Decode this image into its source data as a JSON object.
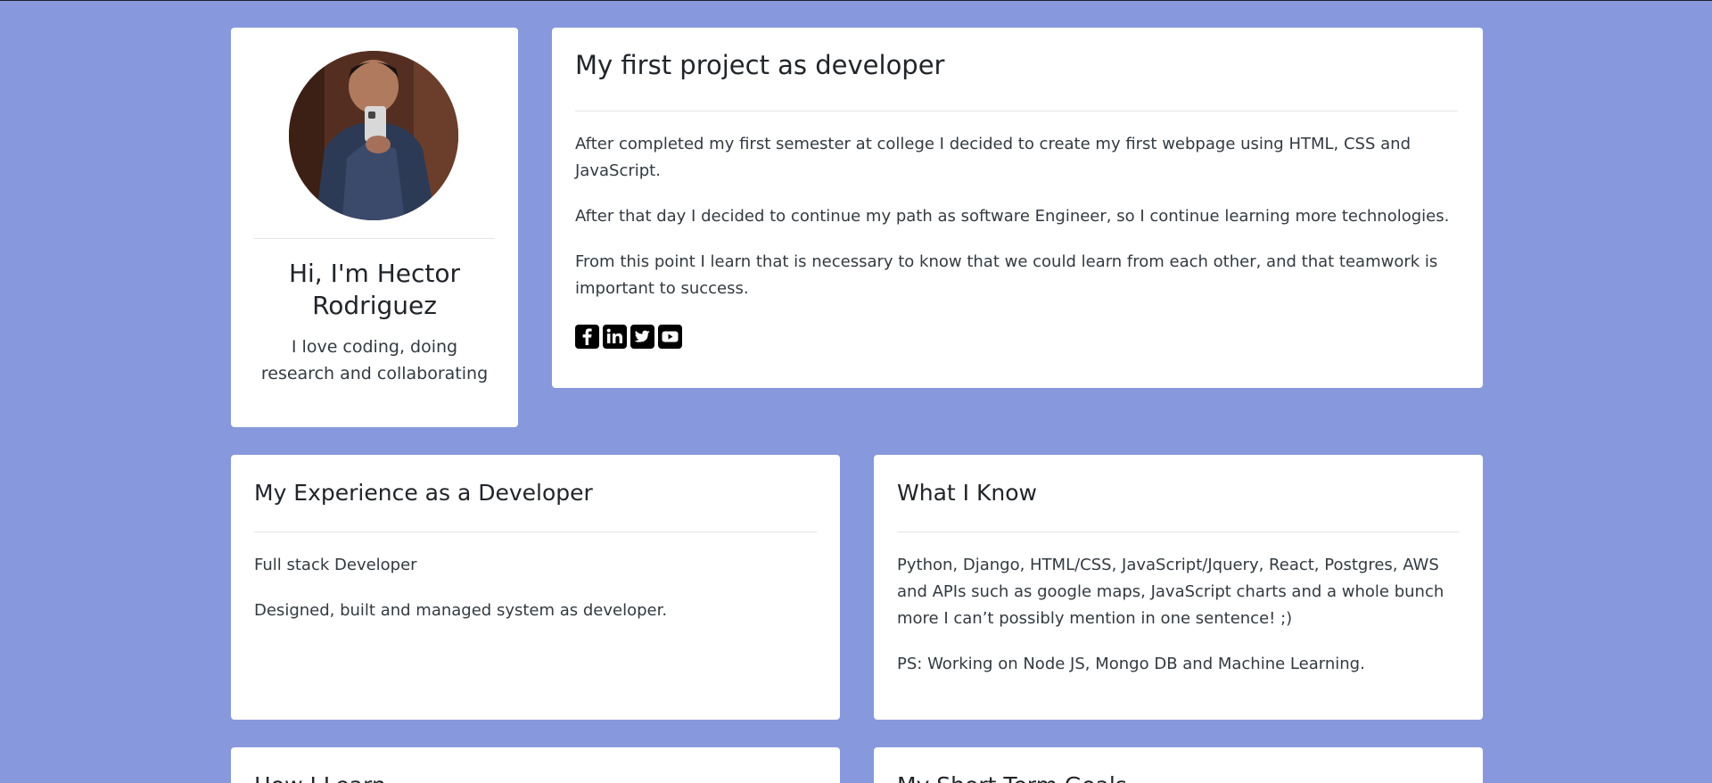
{
  "profile": {
    "name": "Hi, I'm Hector Rodriguez",
    "tagline": "I love coding, doing research and collaborating"
  },
  "project": {
    "title": "My first project as developer",
    "paragraphs": [
      "After completed my first semester at college I decided to create my first webpage using HTML, CSS and JavaScript.",
      "After that day I decided to continue my path as software Engineer, so I continue learning more technologies.",
      "From this point I learn that is necessary to know that we could learn from each other, and that teamwork is important to success."
    ],
    "socials": [
      "facebook-icon",
      "linkedin-icon",
      "twitter-icon",
      "youtube-icon"
    ]
  },
  "experience": {
    "title": "My Experience as a Developer",
    "paragraphs": [
      "Full stack Developer",
      "Designed, built and managed system as developer."
    ]
  },
  "knowledge": {
    "title": "What I Know",
    "paragraphs": [
      "Python, Django, HTML/CSS, JavaScript/Jquery, React, Postgres, AWS and APIs such as google maps, JavaScript charts and a whole bunch more I can’t possibly mention in one sentence! ;)",
      "PS: Working on Node JS, Mongo DB and Machine Learning."
    ]
  },
  "learn": {
    "title": "How I Learn"
  },
  "goals": {
    "title": "My Short Term Goals"
  },
  "colors": {
    "background": "#8799dc",
    "card": "#ffffff",
    "text": "#212529"
  }
}
